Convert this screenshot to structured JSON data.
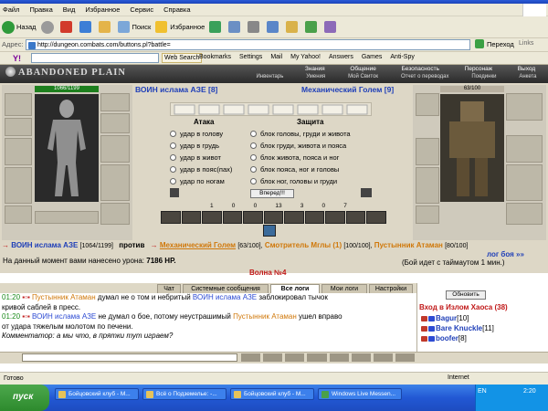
{
  "browser": {
    "menu": [
      "Файл",
      "Правка",
      "Вид",
      "Избранное",
      "Сервис",
      "Справка"
    ],
    "toolbar": {
      "back": "Назад",
      "search": "Поиск",
      "favorites": "Избранное"
    },
    "address": {
      "label": "Адрес:",
      "url": "http://dungeon.combats.com/buttons.pl?battle=",
      "go": "Переход",
      "links": "Links"
    },
    "yahoo": {
      "logo": "Y!",
      "web_search": "Web Search",
      "bookmarks": "Bookmarks",
      "settings": "Settings",
      "mail": "Mail",
      "myyahoo": "My Yahoo!",
      "answers": "Answers",
      "games": "Games",
      "antispy": "Anti-Spy"
    },
    "status": "Готово",
    "zone": "Internet"
  },
  "game": {
    "logo": "ABANDONED PLAIN",
    "nav_top": [
      "Знания",
      "Общение",
      "Безопасность",
      "Персонаж",
      "Выход"
    ],
    "nav_bottom": [
      "Инвентарь",
      "Умения",
      "Мой Свиток",
      "Отчет о переводах",
      "Поединки",
      "Анкета"
    ],
    "left_fighter": {
      "name": "ВОИН ислама АЗЕ [8]",
      "hp": "1066/1199"
    },
    "right_fighter": {
      "name": "Механический Голем [9]",
      "hp": "63/100"
    },
    "attack_head": "Атака",
    "defense_head": "Защита",
    "attacks": [
      "удар в голову",
      "удар в грудь",
      "удар в живот",
      "удар в пояс(пах)",
      "удар по ногам"
    ],
    "defenses": [
      "блок головы, груди и живота",
      "блок груди, живота и пояса",
      "блок живота, пояса и ног",
      "блок пояса, ног и головы",
      "блок ног, головы и груди"
    ],
    "go_button": "Вперед!!!",
    "stats": [
      "1",
      "0",
      "0",
      "13",
      "3",
      "0",
      "7"
    ],
    "battle": {
      "player": "ВОИН ислама АЗЕ",
      "player_hp": "[1064/1199]",
      "vs": "против",
      "enemy1": "Механический Голем",
      "enemy1_hp": "[63/100],",
      "enemy2": "Смотритель Мглы (1)",
      "enemy2_hp": "[100/100],",
      "enemy3": "Пустынник Атаман",
      "enemy3_hp": "[80/100]",
      "damage_label": "На данный момент вами нанесено урона:",
      "damage_value": "7186 HP.",
      "log_link": "лог боя »»",
      "timeout": "(Бой идет с таймаутом 1 мин.)",
      "wave": "Волна №4"
    }
  },
  "chat": {
    "tabs": [
      "Чат",
      "Системные сообщения",
      "Все логи",
      "Мои логи",
      "Настройки"
    ],
    "lines": [
      {
        "time": "01:20",
        "name": "Пустынник Атаман",
        "text": "думал не о том и небритый",
        "name2": "ВОИН ислама АЗЕ",
        "text2": "заблокировал тычок"
      },
      {
        "time": "",
        "name": "",
        "text": "кривой саблей в пресс.",
        "name2": "",
        "text2": ""
      },
      {
        "time": "01:20",
        "name": "ВОИН ислама АЗЕ",
        "text": "не думал о бое, потому неустрашимый",
        "name2": "Пустынник Атаман",
        "text2": "ушел вправо"
      },
      {
        "time": "",
        "name": "",
        "text": "от удара тяжелым молотом по печени.",
        "name2": "",
        "text2": ""
      },
      {
        "time": "",
        "name": "",
        "text": "Комментатор: а мы что, в прятки тут играем?",
        "name2": "",
        "text2": ""
      }
    ],
    "refresh": "Обновить",
    "room": "Вход в Излом Хаоса (38)",
    "users": [
      {
        "name": "Bagur",
        "level": "[10]"
      },
      {
        "name": "Bare Knuckle",
        "level": "[11]"
      },
      {
        "name": "boofer",
        "level": "[8]"
      }
    ]
  },
  "taskbar": {
    "start": "пуск",
    "tasks": [
      "Бойцовский клуб - М...",
      "Всё о Подземелье: -...",
      "Бойцовский клуб - М...",
      "Windows Live Messen..."
    ],
    "lang": "EN",
    "clock": "2:20"
  },
  "colors": {
    "link_blue": "#1f3fb8",
    "name_orange": "#d0780a",
    "wave_red": "#c01818",
    "time_green": "#1a8a1a"
  }
}
